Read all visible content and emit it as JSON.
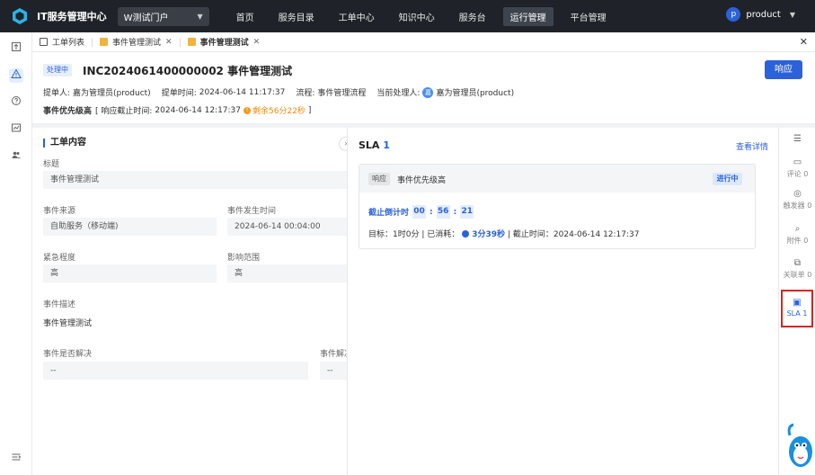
{
  "app": {
    "title": "IT服务管理中心",
    "portal": "W测试门户"
  },
  "nav": [
    "首页",
    "服务目录",
    "工单中心",
    "知识中心",
    "服务台",
    "运行管理",
    "平台管理"
  ],
  "nav_active": "运行管理",
  "user": {
    "initial": "p",
    "name": "product"
  },
  "tabs": [
    {
      "label": "工单列表",
      "icon": "doc-icon"
    },
    {
      "label": "事件管理测试",
      "icon": "folder-icon"
    },
    {
      "label": "事件管理测试",
      "icon": "folder-icon"
    }
  ],
  "header": {
    "status": "处理中",
    "title": "INC2024061400000002 事件管理测试",
    "respond_btn": "响应",
    "submitter_label": "提单人:",
    "submitter": "嘉为管理员(product)",
    "submit_time_label": "提单时间:",
    "submit_time": "2024-06-14 11:17:37",
    "flow_label": "流程:",
    "flow": "事件管理流程",
    "handler_label": "当前处理人:",
    "handler_avatar": "嘉",
    "handler": "嘉为管理员(product)",
    "priority": "事件优先级高",
    "deadline_open": "[ 响应截止时间:",
    "deadline": "2024-06-14 12:17:37",
    "remaining": "剩余56分22秒",
    "deadline_close": "]"
  },
  "content": {
    "section_title": "工单内容",
    "title_label": "标题",
    "title_value": "事件管理测试",
    "source_label": "事件来源",
    "source_value": "自助服务（移动端)",
    "occur_label": "事件发生时间",
    "occur_value": "2024-06-14 00:04:00",
    "urgency_label": "紧急程度",
    "urgency_value": "高",
    "impact_label": "影响范围",
    "impact_value": "高",
    "desc_label": "事件描述",
    "desc_value": "事件管理测试",
    "resolved_label": "事件是否解决",
    "resolved_value": "--",
    "resolve_label2": "事件解决",
    "resolve_value2": "--"
  },
  "sla": {
    "title": "SLA",
    "count": "1",
    "view_detail": "查看详情",
    "tag": "响应",
    "name": "事件优先级高",
    "state": "进行中",
    "countdown_label": "截止倒计时",
    "hh": "00",
    "mm": "56",
    "ss": "21",
    "target": "目标：1时0分 | 已消耗：",
    "used": "3分39秒",
    "deadline_text": "| 截止时间：2024-06-14 12:17:37"
  },
  "rightbar": [
    {
      "label": "",
      "icon": "collapse-list-icon"
    },
    {
      "label": "评论 0",
      "icon": "comment-icon"
    },
    {
      "label": "触发器 0",
      "icon": "trigger-icon"
    },
    {
      "label": "附件 0",
      "icon": "attachment-icon"
    },
    {
      "label": "关联单 0",
      "icon": "link-ticket-icon"
    },
    {
      "label": "SLA 1",
      "icon": "sla-icon"
    }
  ],
  "colors": {
    "accent": "#2b62d9",
    "topbar": "#1f2329",
    "warn": "#f29b1d",
    "highlight": "#e02020"
  }
}
